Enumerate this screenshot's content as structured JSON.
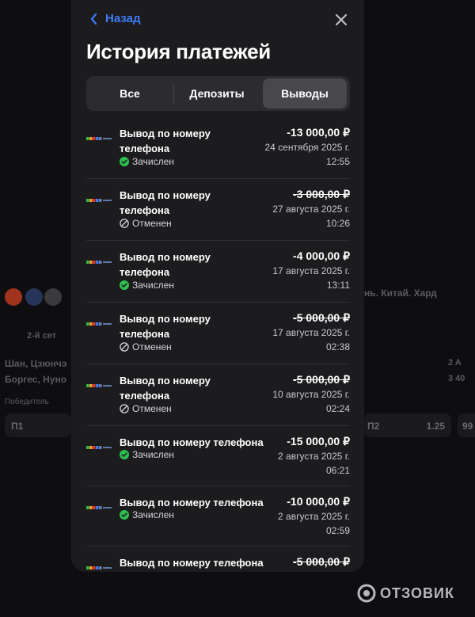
{
  "header": {
    "back_label": "Назад",
    "title": "История платежей"
  },
  "tabs": [
    {
      "label": "Все",
      "active": false
    },
    {
      "label": "Депозиты",
      "active": false
    },
    {
      "label": "Выводы",
      "active": true
    }
  ],
  "transactions": [
    {
      "name": "Вывод по номеру телефона",
      "amount": "-13 000,00 ₽",
      "date": "24 сентября 2025 г.",
      "time": "12:55",
      "status": "Зачислен",
      "state": "success"
    },
    {
      "name": "Вывод по номеру телефона",
      "amount": "-3 000,00 ₽",
      "date": "27 августа 2025 г.",
      "time": "10:26",
      "status": "Отменен",
      "state": "cancelled"
    },
    {
      "name": "Вывод по номеру телефона",
      "amount": "-4 000,00 ₽",
      "date": "17 августа 2025 г.",
      "time": "13:11",
      "status": "Зачислен",
      "state": "success"
    },
    {
      "name": "Вывод по номеру телефона",
      "amount": "-5 000,00 ₽",
      "date": "17 августа 2025 г.",
      "time": "02:38",
      "status": "Отменен",
      "state": "cancelled"
    },
    {
      "name": "Вывод по номеру телефона",
      "amount": "-5 000,00 ₽",
      "date": "10 августа 2025 г.",
      "time": "02:24",
      "status": "Отменен",
      "state": "cancelled"
    },
    {
      "name": "Вывод по номеру телефона",
      "amount": "-15 000,00 ₽",
      "date": "2 августа 2025 г.",
      "time": "06:21",
      "status": "Зачислен",
      "state": "success"
    },
    {
      "name": "Вывод по номеру телефона",
      "amount": "-10 000,00 ₽",
      "date": "2 августа 2025 г.",
      "time": "02:59",
      "status": "Зачислен",
      "state": "success"
    },
    {
      "name": "Вывод по номеру телефона",
      "amount": "-5 000,00 ₽",
      "date": "",
      "time": "",
      "status": "",
      "state": "cancelled"
    }
  ],
  "background": {
    "set_label": "2-й сет",
    "player1": "Шан, Цзюнчэ",
    "player2": "Боргес, Нуно",
    "winner_label": "Победитель",
    "p1_label": "П1",
    "tournament": "нь. Китай. Хард",
    "odd_p2": "П2",
    "odd_value": "1.25",
    "odd_other": "99",
    "score_head": "2  A",
    "score_row": "3  40"
  },
  "watermark": "ОТЗОВИК",
  "colors": {
    "accent": "#3d7cf5",
    "success": "#2fbf4f",
    "modal_bg": "#1c1c1f",
    "active_tab": "#47474c"
  },
  "icons": {
    "back": "chevron-left-icon",
    "close": "close-icon",
    "success": "check-circle-icon",
    "cancelled": "cancel-circle-icon",
    "provider": "sbp-logo-icon"
  }
}
